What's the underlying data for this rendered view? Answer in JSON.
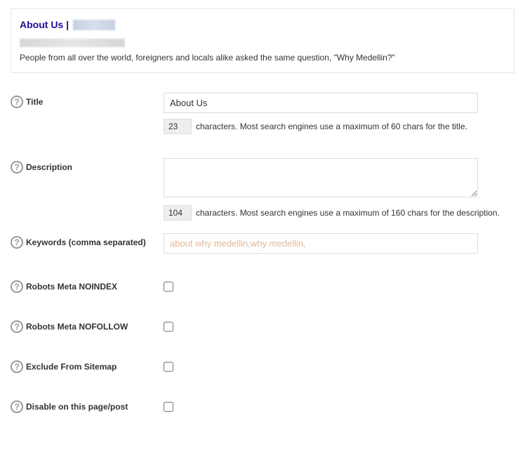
{
  "preview": {
    "title_prefix": "About Us |",
    "description": "People from all over the world, foreigners and locals alike asked the same question, \"Why Medellin?\""
  },
  "fields": {
    "title": {
      "label": "Title",
      "value": "About Us",
      "count": "23",
      "hint": "characters. Most search engines use a maximum of 60 chars for the title."
    },
    "description": {
      "label": "Description",
      "value": "",
      "count": "104",
      "hint": "characters. Most search engines use a maximum of 160 chars for the description."
    },
    "keywords": {
      "label": "Keywords (comma separated)",
      "placeholder": "about why medellin,why medellin,"
    },
    "noindex": {
      "label": "Robots Meta NOINDEX"
    },
    "nofollow": {
      "label": "Robots Meta NOFOLLOW"
    },
    "exclude_sitemap": {
      "label": "Exclude From Sitemap"
    },
    "disable": {
      "label": "Disable on this page/post"
    }
  }
}
